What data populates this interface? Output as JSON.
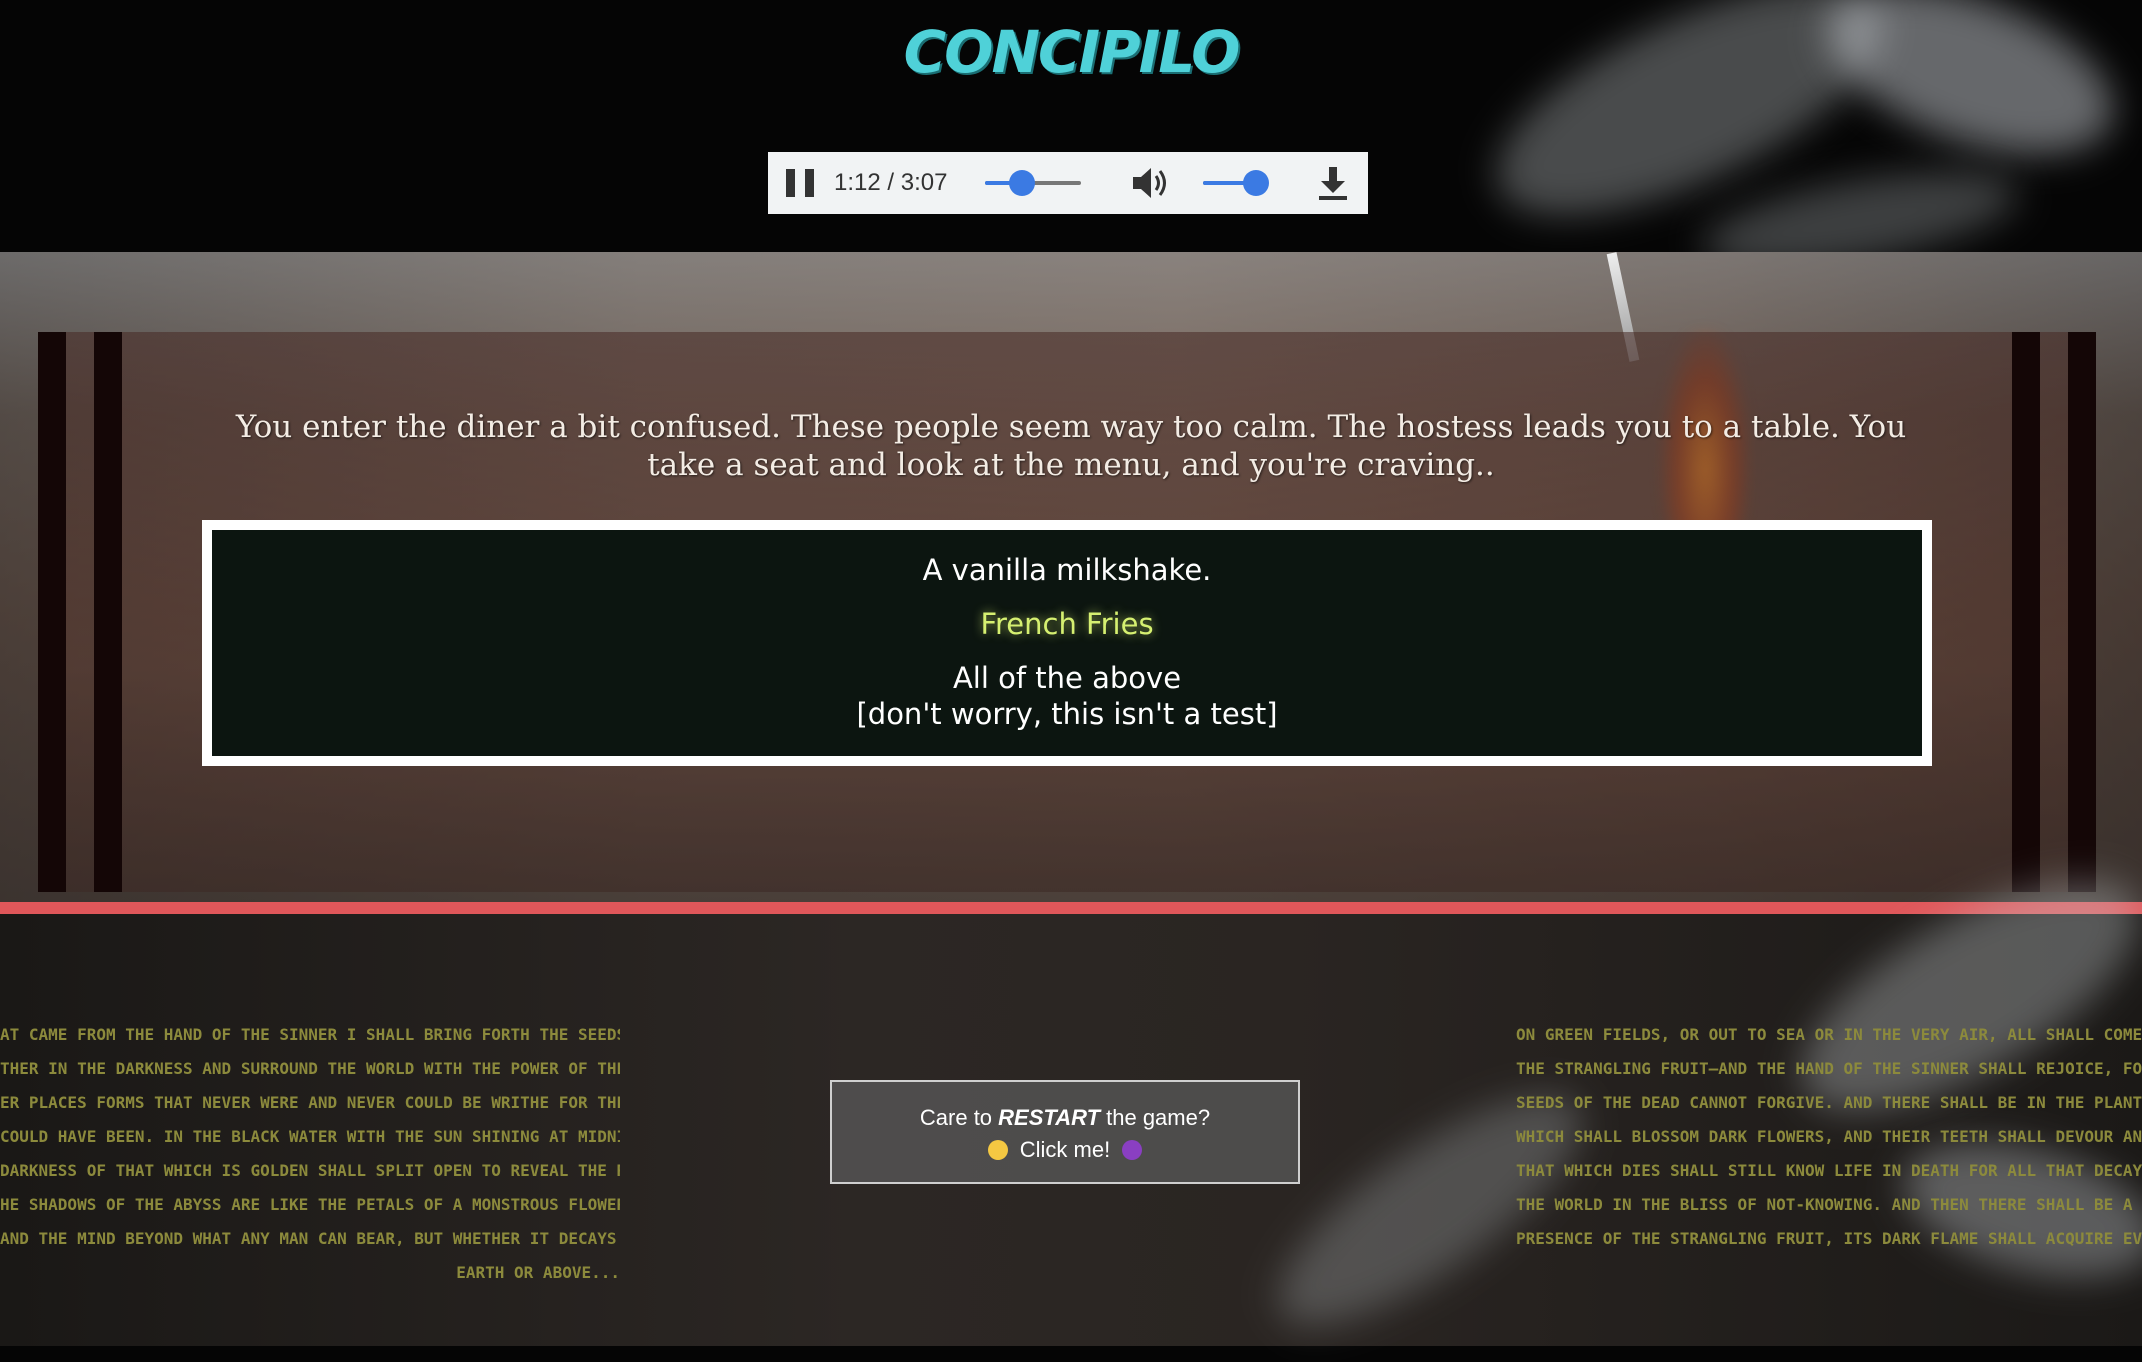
{
  "header": {
    "logo": "CONCIPILO"
  },
  "player": {
    "time": "1:12 / 3:07",
    "progress": 0.385,
    "volume": 0.85
  },
  "story": {
    "text": "You enter the diner a bit confused. These people seem way too calm. The hostess leads you to a table. You take a seat and look at the menu, and you're craving.."
  },
  "choices": [
    {
      "label": "A vanilla milkshake."
    },
    {
      "label": "French Fries"
    },
    {
      "label": "All of the above"
    },
    {
      "label": "[don't worry, this isn't a test]"
    }
  ],
  "restart": {
    "line1_pre": "Care to ",
    "line1_bold": "RESTART",
    "line1_post": " the game?",
    "line2": "Click me!"
  },
  "verse_left": [
    "AT CAME FROM THE HAND OF THE SINNER I SHALL BRING FORTH THE SEEDS OF THE DEAD",
    "THER IN THE DARKNESS AND SURROUND THE WORLD WITH THE POWER OF THEIR LIVES",
    "ER PLACES FORMS THAT NEVER WERE AND NEVER COULD BE WRITHE FOR THE IMPATIENCE",
    "COULD HAVE BEEN. IN THE BLACK WATER WITH THE SUN SHINING AT MIDNIGHT, THOSE",
    "DARKNESS OF THAT WHICH IS GOLDEN SHALL SPLIT OPEN TO REVEAL THE REVELATION OF",
    "HE SHADOWS OF THE ABYSS ARE LIKE THE PETALS OF A MONSTROUS FLOWER THAT SHALL",
    "AND THE MIND BEYOND WHAT ANY MAN CAN BEAR, BUT WHETHER IT DECAYS UNDER THE",
    "EARTH OR ABOVE..."
  ],
  "verse_right": [
    "ON GREEN FIELDS, OR OUT TO SEA OR IN THE VERY AIR, ALL SHALL COME TO REVELATION, A",
    "THE STRANGLING FRUIT—AND THE HAND OF THE SINNER SHALL REJOICE, FOR THERE IS NO S",
    "SEEDS OF THE DEAD CANNOT FORGIVE. AND THERE SHALL BE IN THE PLANTING IN THE SH",
    "WHICH SHALL BLOSSOM DARK FLOWERS, AND THEIR TEETH SHALL DEVOUR AND SUSTAIN A",
    "THAT WHICH DIES SHALL STILL KNOW LIFE IN DEATH FOR ALL THAT DECAYS IS NOT FORGOT",
    "THE WORLD IN THE BLISS OF NOT-KNOWING. AND THEN THERE SHALL BE A FIRE THAT KNO",
    "PRESENCE OF THE STRANGLING FRUIT, ITS DARK FLAME SHALL ACQUIRE EVERY PO"
  ],
  "colors": {
    "logo": "#4fd1d8",
    "selected_choice": "#d6f071",
    "divider": "#e0575a",
    "player_accent": "#3b7ae3",
    "verse": "#8c8a3c"
  }
}
